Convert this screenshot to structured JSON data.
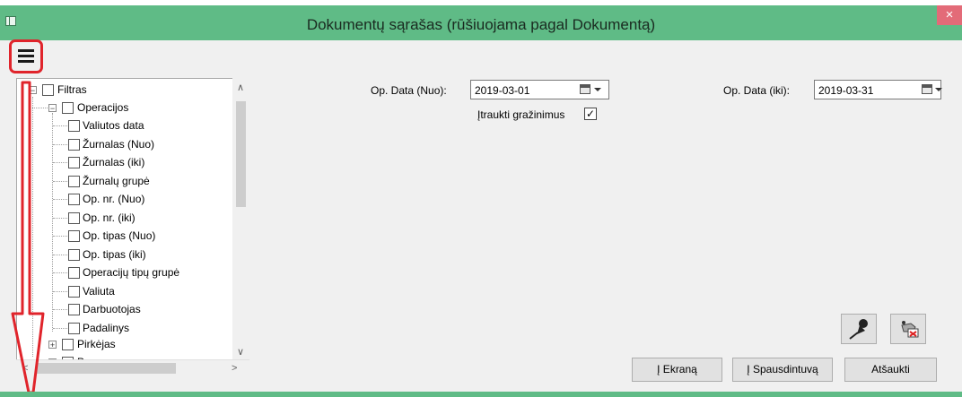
{
  "window": {
    "title": "Dokumentų sąrašas (rūšiuojama pagal Dokumentą)",
    "close_glyph": "×"
  },
  "menu_button": {
    "icon": "hamburger-menu-icon",
    "highlight_color": "#e0242b"
  },
  "tree": {
    "root": {
      "label": "Filtras",
      "expanded": true,
      "checked": false
    },
    "operacijos": {
      "label": "Operacijos",
      "expanded": true,
      "checked": false
    },
    "children": [
      "Valiutos data",
      "Žurnalas (Nuo)",
      "Žurnalas (iki)",
      "Žurnalų grupė",
      "Op. nr. (Nuo)",
      "Op. nr. (iki)",
      "Op. tipas (Nuo)",
      "Op. tipas (iki)",
      "Operacijų tipų grupė",
      "Valiuta",
      "Darbuotojas",
      "Padalinys"
    ],
    "pirkejas": {
      "label": "Pirkėjas",
      "expanded": false,
      "checked": false
    },
    "partial_label": "Pa..."
  },
  "filters": {
    "date_from_label": "Op. Data (Nuo):",
    "date_from_value": "2019-03-01",
    "date_to_label": "Op. Data (iki):",
    "date_to_value": "2019-03-31",
    "include_returns_label": "Įtraukti gražinimus",
    "include_returns_checked": "✓"
  },
  "buttons": {
    "screen": "Į Ekraną",
    "printer": "Į Spausdintuvą",
    "cancel": "Atšaukti",
    "pin_icon": "pin-icon",
    "settings_icon": "edit-settings-icon"
  },
  "colors": {
    "titlebar": "#5fbb86",
    "close": "#e36b78",
    "annotation_red": "#e0242b"
  }
}
